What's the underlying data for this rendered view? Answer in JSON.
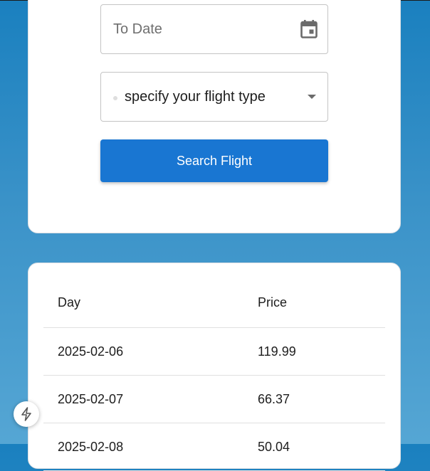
{
  "form": {
    "to_date_placeholder": "To Date",
    "flight_type_placeholder": "specify your flight type",
    "search_button": "Search Flight"
  },
  "table": {
    "headers": [
      "Day",
      "Price"
    ],
    "rows": [
      {
        "day": "2025-02-06",
        "price": "119.99"
      },
      {
        "day": "2025-02-07",
        "price": "66.37"
      },
      {
        "day": "2025-02-08",
        "price": "50.04"
      }
    ]
  },
  "icons": {
    "calendar": "calendar-icon",
    "dropdown": "chevron-down-icon",
    "devtools": "lightning-bolt-icon"
  },
  "colors": {
    "button": "#1976d2",
    "background_top": "#1a80bf",
    "background_bottom": "#55a6d4"
  }
}
